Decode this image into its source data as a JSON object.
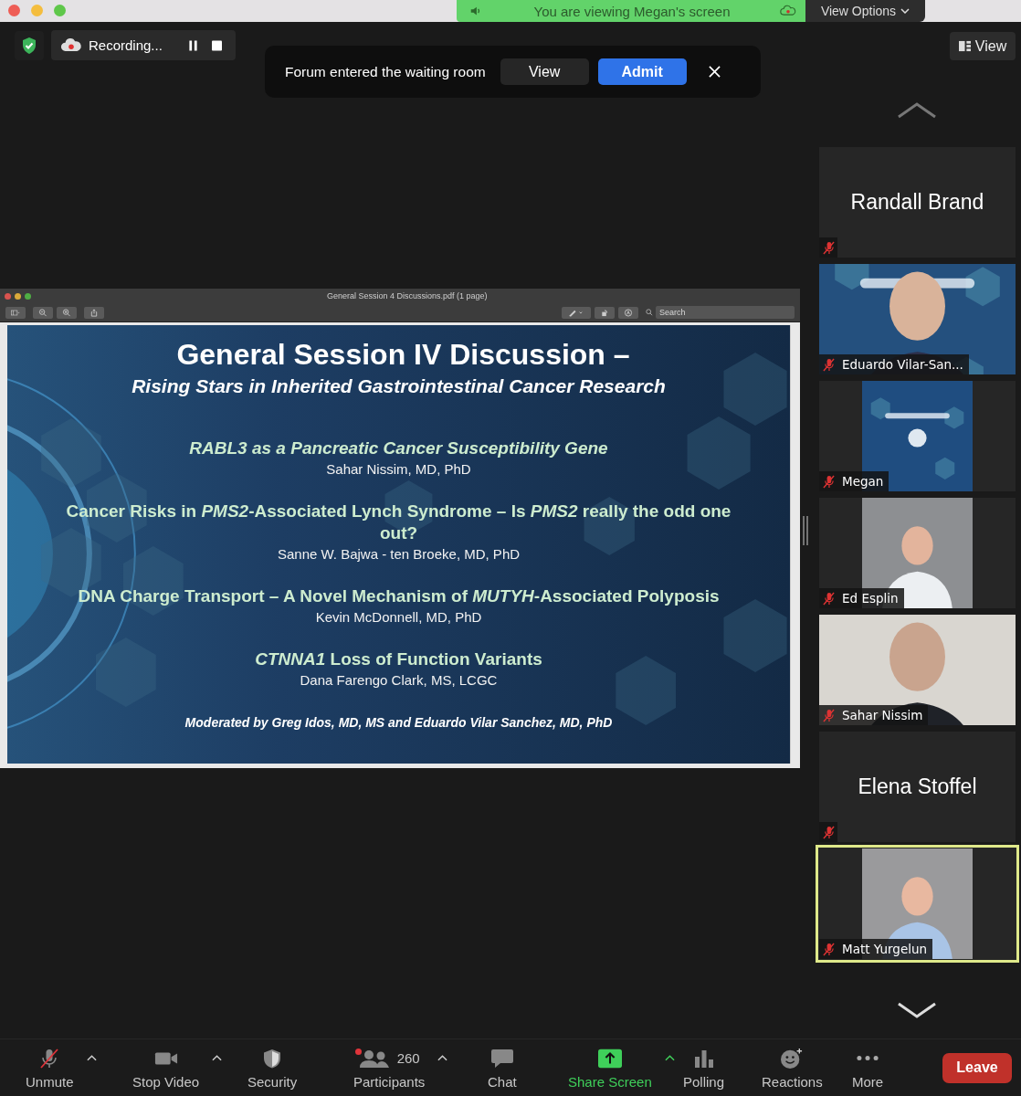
{
  "share_banner": {
    "text": "You are viewing Megan's screen"
  },
  "view_options": {
    "label": "View Options"
  },
  "recording": {
    "label": "Recording..."
  },
  "notification": {
    "text": "Forum entered the waiting room",
    "buttons": [
      {
        "label": "View",
        "primary": false
      },
      {
        "label": "Admit",
        "primary": true
      }
    ]
  },
  "view_button": {
    "label": "View"
  },
  "shared_document": {
    "title": "General Session 4 Discussions.pdf (1 page)",
    "search_placeholder": "Search",
    "slide": {
      "title": "General Session IV Discussion –",
      "subtitle": "Rising Stars in Inherited Gastrointestinal Cancer Research",
      "talks": [
        {
          "title": "RABL3 as a Pancreatic Cancer Susceptibility Gene",
          "italic": true,
          "speaker": "Sahar Nissim, MD, PhD"
        },
        {
          "title": "Cancer Risks in *PMS2*-Associated Lynch Syndrome – Is *PMS2* really the odd one out?",
          "italic": false,
          "speaker": "Sanne W. Bajwa - ten Broeke, MD, PhD"
        },
        {
          "title": "DNA Charge Transport – A Novel Mechanism of *MUTYH*-Associated Polyposis",
          "italic": false,
          "speaker": "Kevin McDonnell, MD, PhD"
        },
        {
          "title": "*CTNNA1* Loss of Function Variants",
          "italic": false,
          "speaker": "Dana Farengo Clark, MS, LCGC"
        }
      ],
      "footer": "Moderated by Greg Idos, MD, MS and Eduardo Vilar Sanchez, MD, PhD"
    }
  },
  "participants": [
    {
      "name": "Randall Brand",
      "kind": "name",
      "muted": true,
      "speaking": false
    },
    {
      "name": "Eduardo Vilar-San...",
      "kind": "video",
      "muted": true,
      "speaking": false
    },
    {
      "name": "Megan",
      "kind": "portrait",
      "muted": true,
      "speaking": false
    },
    {
      "name": "Ed Esplin",
      "kind": "portrait",
      "muted": true,
      "speaking": false
    },
    {
      "name": "Sahar Nissim",
      "kind": "video",
      "muted": true,
      "speaking": false
    },
    {
      "name": "Elena Stoffel",
      "kind": "name",
      "muted": true,
      "speaking": false
    },
    {
      "name": "Matt Yurgelun",
      "kind": "portrait",
      "muted": true,
      "speaking": true
    }
  ],
  "toolbar": {
    "items": [
      {
        "label": "Unmute",
        "kind": "audio",
        "muted": true,
        "menu": true
      },
      {
        "label": "Stop Video",
        "kind": "video",
        "menu": true
      },
      {
        "label": "Security",
        "kind": "security",
        "menu": false
      },
      {
        "label": "Participants",
        "kind": "participants",
        "count": "260",
        "alert": true,
        "menu": true
      },
      {
        "label": "Chat",
        "kind": "chat",
        "menu": false
      },
      {
        "label": "Share Screen",
        "kind": "share",
        "menu": true
      },
      {
        "label": "Polling",
        "kind": "polling",
        "menu": false
      },
      {
        "label": "Reactions",
        "kind": "reactions",
        "menu": false
      },
      {
        "label": "More",
        "kind": "more",
        "menu": false
      }
    ],
    "leave": {
      "label": "Leave"
    }
  }
}
